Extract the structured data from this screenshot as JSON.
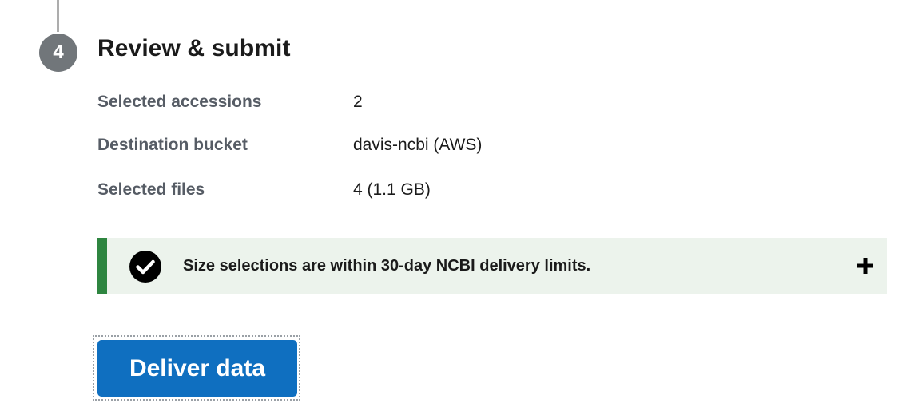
{
  "step": {
    "number": "4",
    "title": "Review & submit"
  },
  "summary": {
    "rows": [
      {
        "label": "Selected accessions",
        "value": "2"
      },
      {
        "label": "Destination bucket",
        "value": "davis-ncbi (AWS)"
      },
      {
        "label": "Selected files",
        "value": "4 (1.1 GB)"
      }
    ]
  },
  "alert": {
    "status": "success",
    "icon": "check-circle-icon",
    "text": "Size selections are within 30-day NCBI delivery limits.",
    "toggle_icon": "plus-icon",
    "accent_color": "#2e8540",
    "background_color": "#ecf3ec"
  },
  "actions": {
    "deliver_label": "Deliver data",
    "button_color": "#0f6fc0"
  }
}
